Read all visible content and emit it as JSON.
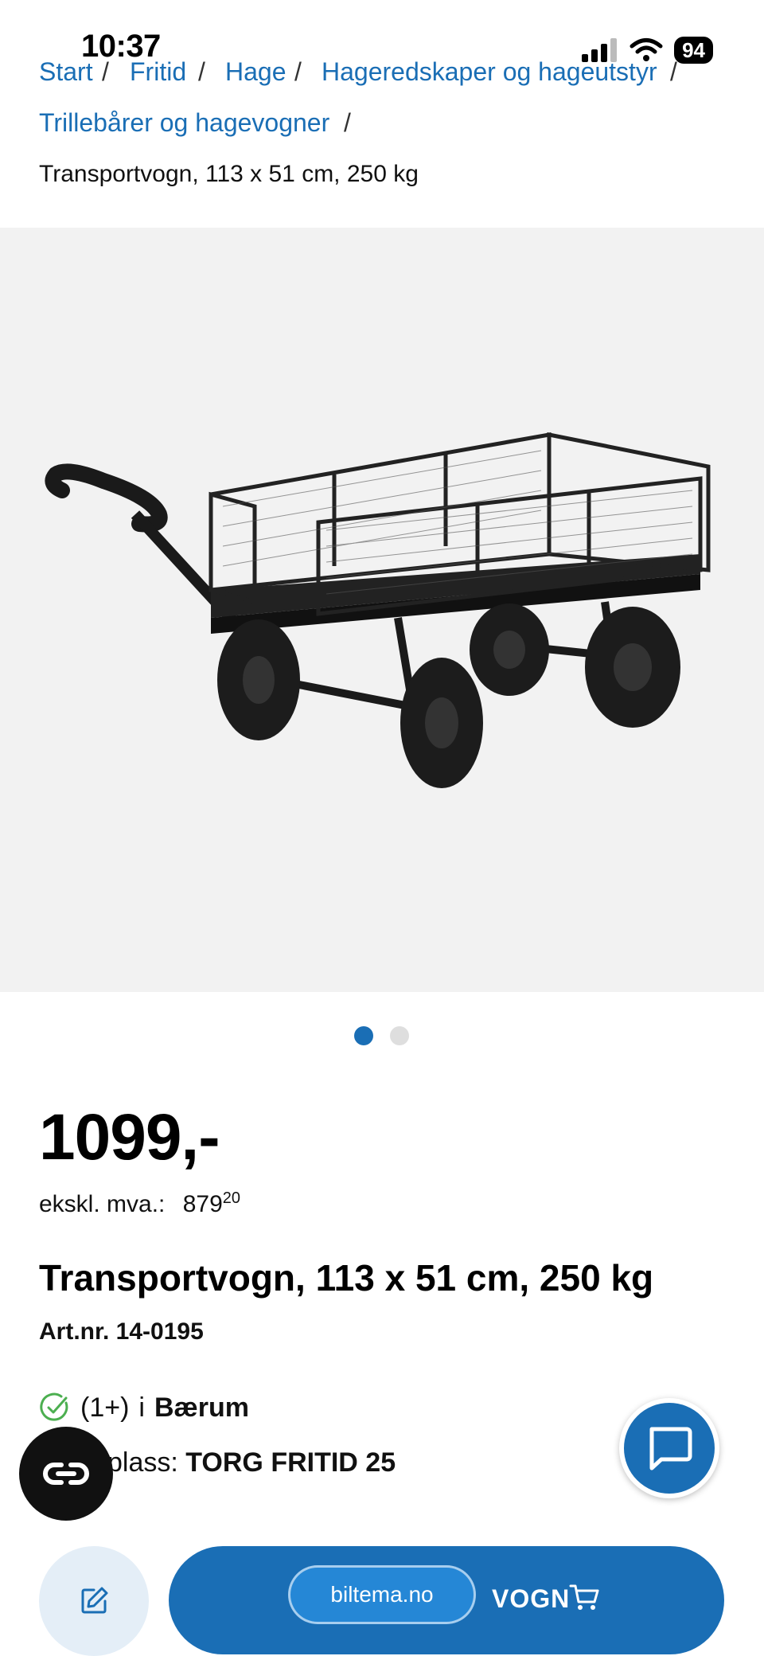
{
  "status_bar": {
    "time": "10:37",
    "battery": "94"
  },
  "breadcrumb": {
    "items": [
      "Start",
      "Fritid",
      "Hage",
      "Hageredskaper og hageutstyr",
      "Trillebårer og hagevogner"
    ],
    "separator": "/",
    "current": "Transportvogn, 113 x 51 cm, 250 kg"
  },
  "gallery": {
    "image_count": 2,
    "active_index": 0
  },
  "product": {
    "price": "1099,-",
    "ex_vat_label": "ekskl. mva.:",
    "ex_vat_main": "879",
    "ex_vat_cents": "20",
    "title": "Transportvogn, 113 x 51 cm, 250 kg",
    "article_number": "Art.nr. 14-0195",
    "stock_count": "(1+)",
    "stock_in": "i",
    "stock_store": "Bærum",
    "location_label": "plass:",
    "location_value": "TORG FRITID 25"
  },
  "actions": {
    "add_to_cart_label": "VOGN"
  },
  "browser": {
    "url": "biltema.no"
  },
  "colors": {
    "accent": "#1a6eb5",
    "stock_ok": "#4caf50"
  }
}
